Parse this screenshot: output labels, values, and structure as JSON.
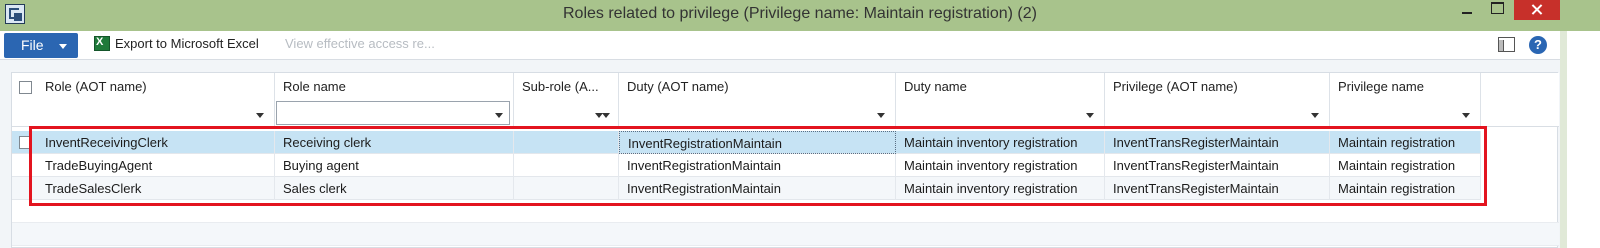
{
  "window": {
    "title": "Roles related to privilege (Privilege name: Maintain registration) (2)"
  },
  "toolbar": {
    "file_label": "File",
    "export_label": "Export to Microsoft Excel",
    "view_access_label": "View effective access re..."
  },
  "icons": {
    "app": "dynamics-app-icon",
    "excel": "excel-icon",
    "layout": "layout-icon",
    "help": "help-icon",
    "help_glyph": "?"
  },
  "grid": {
    "columns": [
      "Role (AOT name)",
      "Role name",
      "Sub-role (A...",
      "Duty (AOT name)",
      "Duty name",
      "Privilege (AOT name)",
      "Privilege name"
    ],
    "rows": [
      [
        "InventReceivingClerk",
        "Receiving clerk",
        "",
        "InventRegistrationMaintain",
        "Maintain inventory registration",
        "InventTransRegisterMaintain",
        "Maintain registration"
      ],
      [
        "TradeBuyingAgent",
        "Buying agent",
        "",
        "InventRegistrationMaintain",
        "Maintain inventory registration",
        "InventTransRegisterMaintain",
        "Maintain registration"
      ],
      [
        "TradeSalesClerk",
        "Sales clerk",
        "",
        "InventRegistrationMaintain",
        "Maintain inventory registration",
        "InventTransRegisterMaintain",
        "Maintain registration"
      ]
    ]
  },
  "colors": {
    "title_bar": "#a8c38c",
    "file_button": "#2b66b2",
    "selected_row": "#c6e3f4",
    "highlight_box": "#e3141f"
  }
}
